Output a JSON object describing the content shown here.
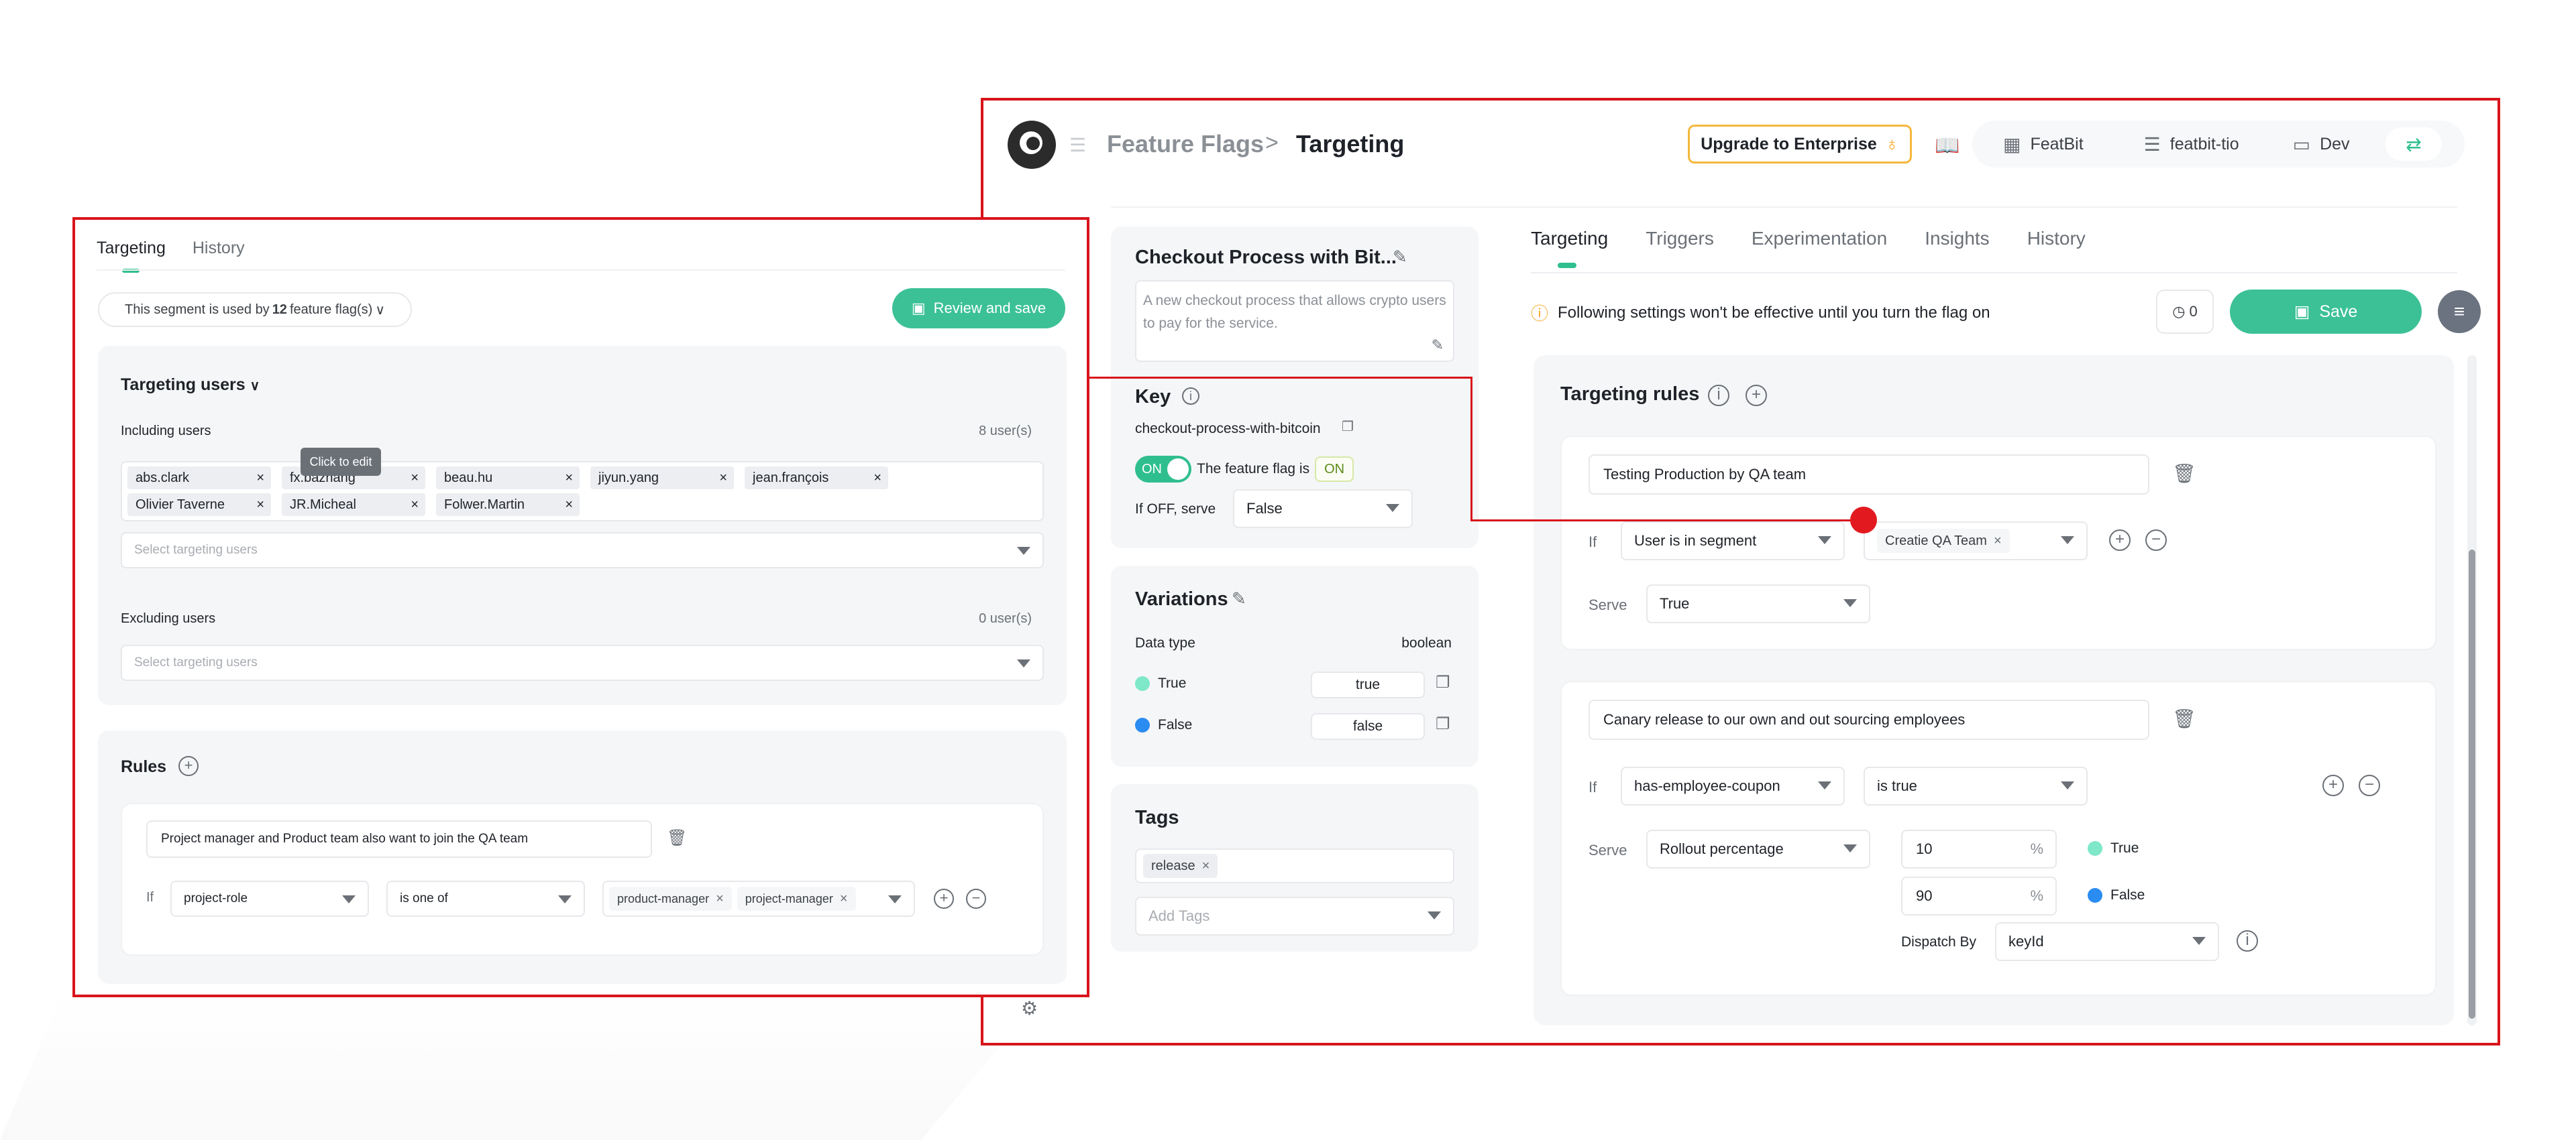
{
  "header": {
    "crumb_section": "Feature Flags",
    "crumb_sep": ">",
    "crumb_page": "Targeting",
    "upgrade_label": "Upgrade to Enterprise",
    "org": "FeatBit",
    "project": "featbit-tio",
    "env": "Dev"
  },
  "flag": {
    "name": "Checkout Process with Bit...",
    "description": "A new checkout process that allows crypto users to pay for the service.",
    "key_label": "Key",
    "key": "checkout-process-with-bitcoin",
    "toggle_label": "ON",
    "status_text": "The feature flag is",
    "status_badge": "ON",
    "off_serve_label": "If OFF, serve",
    "off_serve_value": "False"
  },
  "variations": {
    "title": "Variations",
    "data_type_label": "Data type",
    "data_type": "boolean",
    "items": [
      {
        "name": "True",
        "value": "true",
        "color": "#7ee8c8"
      },
      {
        "name": "False",
        "value": "false",
        "color": "#2a8cf0"
      }
    ]
  },
  "tags": {
    "title": "Tags",
    "items": [
      "release"
    ],
    "placeholder": "Add Tags"
  },
  "tabs": [
    "Targeting",
    "Triggers",
    "Experimentation",
    "Insights",
    "History"
  ],
  "warning": "Following settings won't be effective until you turn the flag on",
  "history_count": "0",
  "save_label": "Save",
  "targeting_rules": {
    "title": "Targeting rules",
    "rules": [
      {
        "name": "Testing Production by QA team",
        "if_label": "If",
        "condition": "User is in segment",
        "segment": "Creatie QA Team",
        "serve_label": "Serve",
        "serve": "True"
      },
      {
        "name": "Canary release to our own and out sourcing employees",
        "if_label": "If",
        "property": "has-employee-coupon",
        "operator": "is true",
        "serve_label": "Serve",
        "serve": "Rollout percentage",
        "rollout": [
          {
            "percent": "10",
            "unit": "%",
            "variation": "True",
            "color": "#7ee8c8"
          },
          {
            "percent": "90",
            "unit": "%",
            "variation": "False",
            "color": "#2a8cf0"
          }
        ],
        "dispatch_label": "Dispatch By",
        "dispatch": "keyId"
      }
    ]
  },
  "segment": {
    "tabs": [
      "Targeting",
      "History"
    ],
    "used_by_prefix": "This segment is used by",
    "used_by_count": "12",
    "used_by_suffix": "feature flag(s)",
    "review_label": "Review and save",
    "targeting_users_title": "Targeting users",
    "including_label": "Including users",
    "including_count": "8 user(s)",
    "included_users": [
      "abs.clark",
      "fx.bazhang",
      "beau.hu",
      "jiyun.yang",
      "jean.françois",
      "Olivier Taverne",
      "JR.Micheal",
      "Folwer.Martin"
    ],
    "tooltip": "Click to edit",
    "select_placeholder": "Select targeting users",
    "excluding_label": "Excluding users",
    "excluding_count": "0 user(s)",
    "rules_title": "Rules",
    "rule_name": "Project manager and Product team also want to join the QA team",
    "rule_if": "If",
    "rule_property": "project-role",
    "rule_operator": "is one of",
    "rule_values": [
      "product-manager",
      "project-manager"
    ]
  },
  "colors": {
    "accent": "#3cc197",
    "highlight": "#d9141b",
    "warning": "#f5a623"
  }
}
